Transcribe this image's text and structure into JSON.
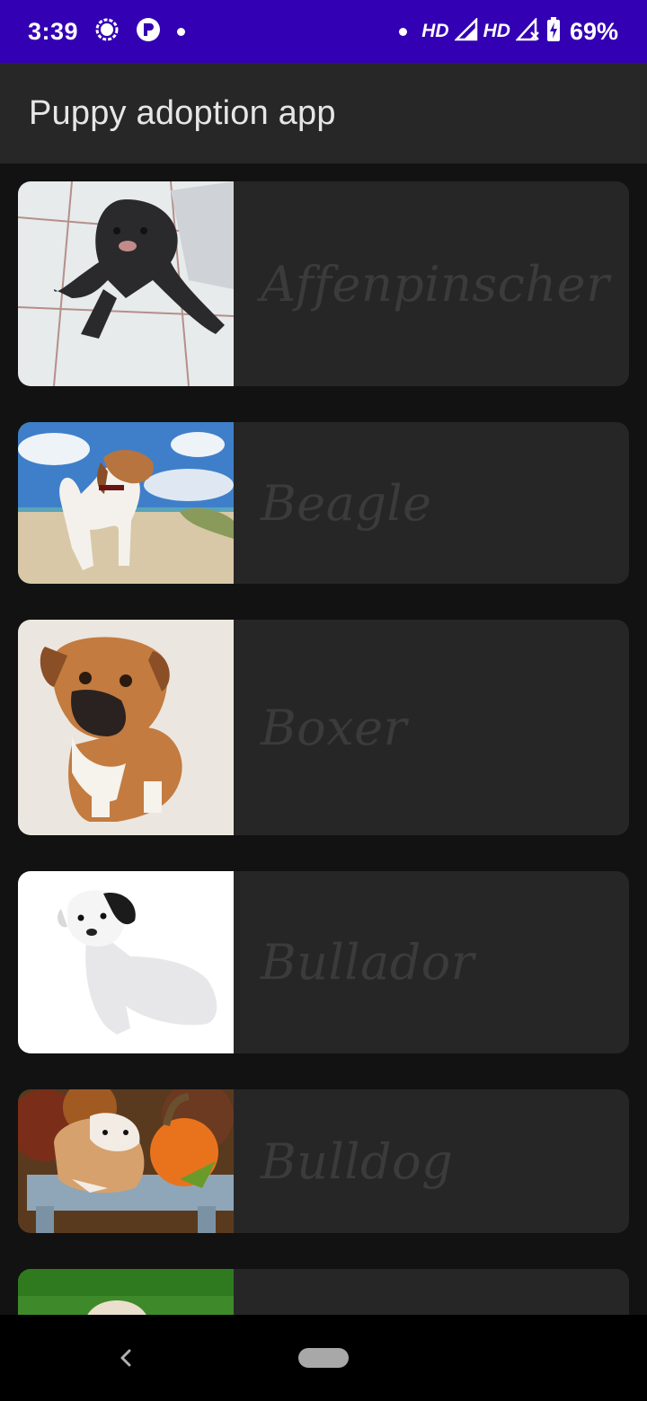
{
  "status_bar": {
    "time": "3:39",
    "network_1": "HD",
    "network_2": "HD",
    "battery": "69%"
  },
  "app_bar": {
    "title": "Puppy adoption app"
  },
  "puppies": [
    {
      "name": "Affenpinscher"
    },
    {
      "name": "Beagle"
    },
    {
      "name": "Boxer"
    },
    {
      "name": "Bullador"
    },
    {
      "name": "Bulldog"
    },
    {
      "name": ""
    }
  ],
  "icons": {
    "signal_app": "signal-icon",
    "p_app": "p-app-icon",
    "cell": "cell-signal-icon",
    "battery": "battery-charging-icon",
    "back": "back-icon",
    "home": "home-pill"
  },
  "colors": {
    "status_bar": "#3300b3",
    "app_bar": "#272727",
    "background": "#121212",
    "card": "#262626",
    "card_text": "#3b3b3b"
  }
}
